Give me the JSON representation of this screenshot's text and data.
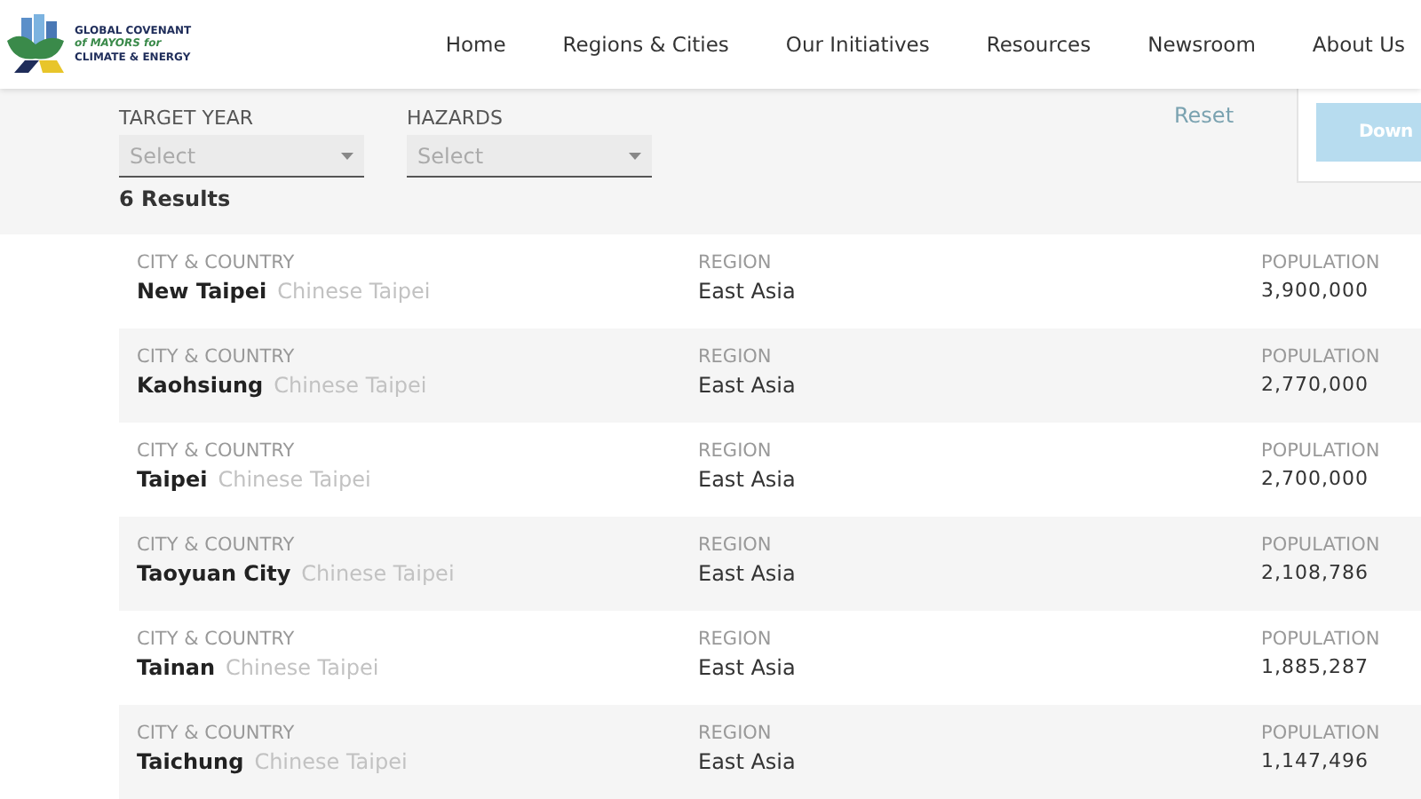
{
  "logo": {
    "lines": [
      "GLOBAL COVENANT",
      "of MAYORS for",
      "CLIMATE & ENERGY"
    ]
  },
  "nav": [
    "Home",
    "Regions & Cities",
    "Our Initiatives",
    "Resources",
    "Newsroom",
    "About Us"
  ],
  "filters": [
    {
      "label": "TARGET YEAR",
      "placeholder": "Select"
    },
    {
      "label": "HAZARDS",
      "placeholder": "Select"
    }
  ],
  "reset": "Reset",
  "download_button": "Down",
  "results_count": "6 Results",
  "rows": [
    {
      "city_label": "CITY & COUNTRY",
      "city": "New Taipei",
      "country": "Chinese Taipei",
      "region_label": "REGION",
      "region": "East Asia",
      "population_label": "POPULATION",
      "population": "3,900,000"
    },
    {
      "city_label": "CITY & COUNTRY",
      "city": "Kaohsiung",
      "country": "Chinese Taipei",
      "region_label": "REGION",
      "region": "East Asia",
      "population_label": "POPULATION",
      "population": "2,770,000"
    },
    {
      "city_label": "CITY & COUNTRY",
      "city": "Taipei",
      "country": "Chinese Taipei",
      "region_label": "REGION",
      "region": "East Asia",
      "population_label": "POPULATION",
      "population": "2,700,000"
    },
    {
      "city_label": "CITY & COUNTRY",
      "city": "Taoyuan City",
      "country": "Chinese Taipei",
      "region_label": "REGION",
      "region": "East Asia",
      "population_label": "POPULATION",
      "population": "2,108,786"
    },
    {
      "city_label": "CITY & COUNTRY",
      "city": "Tainan",
      "country": "Chinese Taipei",
      "region_label": "REGION",
      "region": "East Asia",
      "population_label": "POPULATION",
      "population": "1,885,287"
    },
    {
      "city_label": "CITY & COUNTRY",
      "city": "Taichung",
      "country": "Chinese Taipei",
      "region_label": "REGION",
      "region": "East Asia",
      "population_label": "POPULATION",
      "population": "1,147,496"
    }
  ]
}
